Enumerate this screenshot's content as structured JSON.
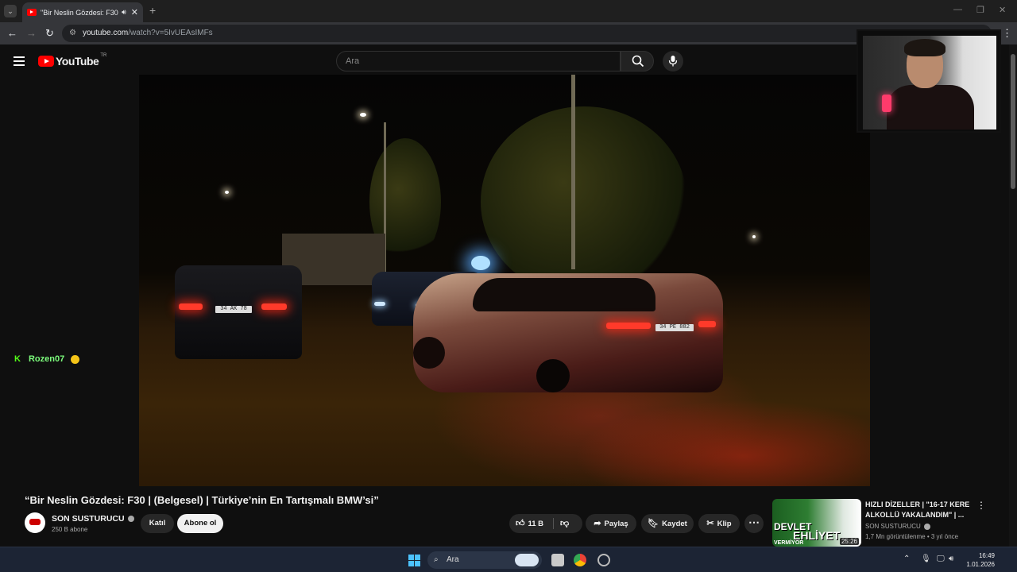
{
  "browser": {
    "tab_title": "\"Bir Neslin Gözdesi: F30 | (B",
    "url_host": "youtube.com",
    "url_path": "/watch?v=5IvUEAsIMFs"
  },
  "youtube": {
    "logo_text": "YouTube",
    "country_code": "TR",
    "search_placeholder": "Ara"
  },
  "chat": {
    "username": "Rozen07",
    "platform_icon": "kick-icon"
  },
  "video": {
    "title": "“Bir Neslin Gözdesi: F30 | (Belgesel) | Türkiye’nin En Tartışmalı BMW’si”",
    "plate_left": "34 AK 78",
    "plate_right": "34 PE 882"
  },
  "channel": {
    "name": "SON SUSTURUCU",
    "subscribers": "250 B abone",
    "join_label": "Katıl",
    "subscribe_label": "Abone ol"
  },
  "actions": {
    "likes": "11 B",
    "share": "Paylaş",
    "save": "Kaydet",
    "clip": "Klip"
  },
  "recommendation": {
    "title": "HIZLI DİZELLER | \"16-17 KERE ALKOLLÜ YAKALANDIM\" | ...",
    "channel": "SON SUSTURUCU",
    "meta": "1,7 Mn görüntülenme • 3 yıl önce",
    "duration": "25:26",
    "thumb_text_1": "DEVLET",
    "thumb_text_2": "EHLİYET",
    "thumb_text_3": "VERMİYOR"
  },
  "taskbar": {
    "search_placeholder": "Ara",
    "time": "16:49",
    "date": "1.01.2026"
  },
  "colors": {
    "youtube_red": "#ff0000",
    "kick_green": "#53fc18",
    "background": "#0f0f0f"
  }
}
